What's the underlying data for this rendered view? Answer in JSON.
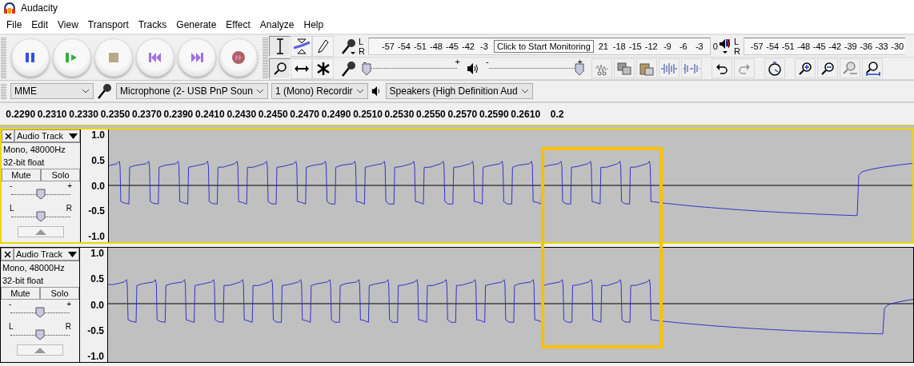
{
  "window": {
    "title": "Audacity"
  },
  "menu": [
    "File",
    "Edit",
    "View",
    "Transport",
    "Tracks",
    "Generate",
    "Effect",
    "Analyze",
    "Help"
  ],
  "record_meter": {
    "channels": [
      "L",
      "R"
    ],
    "ticks_before": [
      "-57",
      "-54",
      "-51",
      "-48",
      "-45",
      "-42",
      "-3"
    ],
    "tooltip": "Click to Start Monitoring",
    "ticks_after": [
      "21",
      "-18",
      "-15",
      "-12",
      "-9",
      "-6",
      "-3",
      "0"
    ]
  },
  "playback_meter": {
    "channels": [
      "L",
      "R"
    ],
    "ticks": [
      "-57",
      "-54",
      "-51",
      "-48",
      "-45",
      "-42",
      "-39",
      "-36",
      "-33",
      "-30"
    ]
  },
  "mixer": {
    "record": {
      "labels": [
        "-",
        "+"
      ],
      "level": 0
    },
    "playback": {
      "labels": [
        "-",
        "+"
      ],
      "level": 1
    }
  },
  "devices": {
    "host": "MME",
    "input": "Microphone (2- USB PnP Soun",
    "channels": "1 (Mono) Recordir",
    "output": "Speakers (High Definition Aud"
  },
  "ruler": [
    "0.2290",
    "0.2310",
    "0.2330",
    "0.2350",
    "0.2370",
    "0.2390",
    "0.2410",
    "0.2430",
    "0.2450",
    "0.2470",
    "0.2490",
    "0.2510",
    "0.2530",
    "0.2550",
    "0.2570",
    "0.2590",
    "0.2610",
    "0.2"
  ],
  "tracks": [
    {
      "name": "Audio Track",
      "info": [
        "Mono, 48000Hz",
        "32-bit float"
      ],
      "mute": "Mute",
      "solo": "Solo",
      "gain": {
        "labels": [
          "-",
          "+"
        ],
        "level": 0.5
      },
      "pan": {
        "labels": [
          "L",
          "R"
        ],
        "level": 0.5
      },
      "selected": true,
      "scale": [
        "1.0",
        "0.5",
        "0.0",
        "-0.5",
        "-1.0"
      ]
    },
    {
      "name": "Audio Track",
      "info": [
        "Mono, 48000Hz",
        "32-bit float"
      ],
      "mute": "Mute",
      "solo": "Solo",
      "gain": {
        "labels": [
          "-",
          "+"
        ],
        "level": 0.5
      },
      "pan": {
        "labels": [
          "L",
          "R"
        ],
        "level": 0.5
      },
      "selected": false,
      "scale": [
        "1.0",
        "0.5",
        "0.0",
        "-0.5",
        "-1.0"
      ]
    }
  ]
}
